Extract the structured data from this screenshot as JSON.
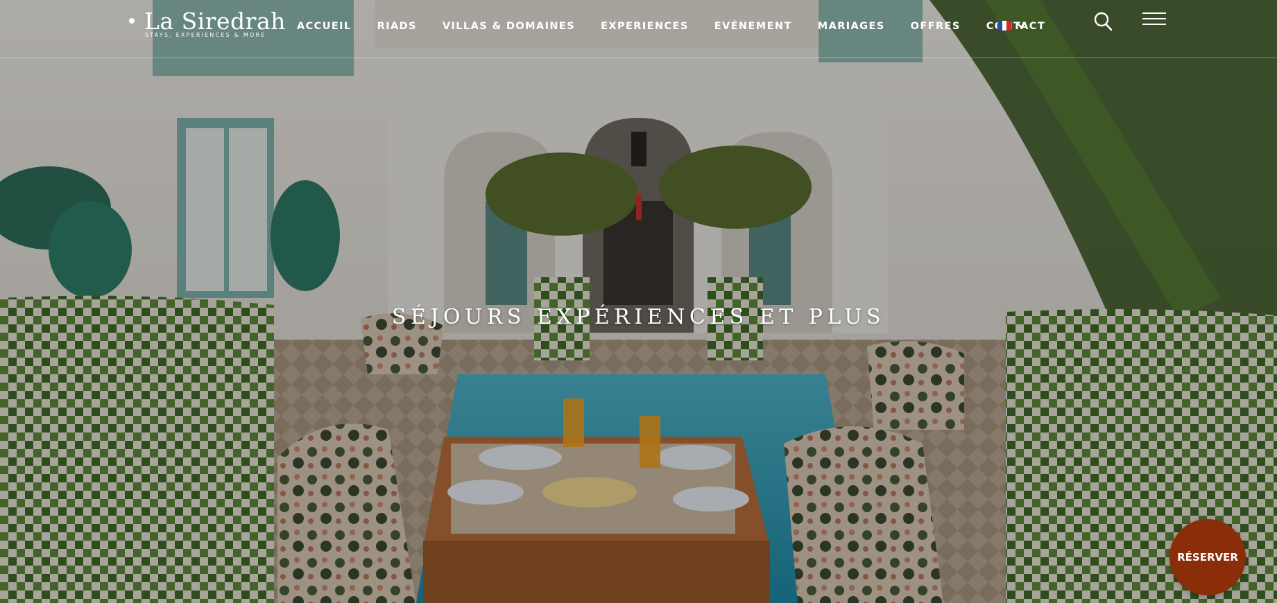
{
  "brand": {
    "name": "La Siredrah",
    "tagline": "STAYS, EXPERIENCES & MORE",
    "logo_icon": "crescent-moon-icon"
  },
  "nav": {
    "items": [
      {
        "label": "ACCUEIL"
      },
      {
        "label": "RIADS"
      },
      {
        "label": "VILLAS & DOMAINES"
      },
      {
        "label": "EXPERIENCES"
      },
      {
        "label": "EVÉNEMENT"
      },
      {
        "label": "MARIAGES"
      },
      {
        "label": "OFFRES"
      },
      {
        "label": "CONTACT"
      }
    ],
    "language": {
      "current": "FR",
      "flag_icon": "flag-fr-icon",
      "dropdown_icon": "chevron-down-icon"
    },
    "search_icon": "search-icon",
    "menu_icon": "hamburger-menu-icon"
  },
  "hero": {
    "title": "SÉJOURS EXPÉRIENCES ET PLUS",
    "image_subject": "riad courtyard with pool, palms and breakfast table"
  },
  "cta": {
    "reserve_label": "RÉSERVER"
  },
  "colors": {
    "cta_background": "#8a2e0a",
    "text": "#ffffff",
    "overlay": "rgba(0,0,0,0.28)"
  }
}
